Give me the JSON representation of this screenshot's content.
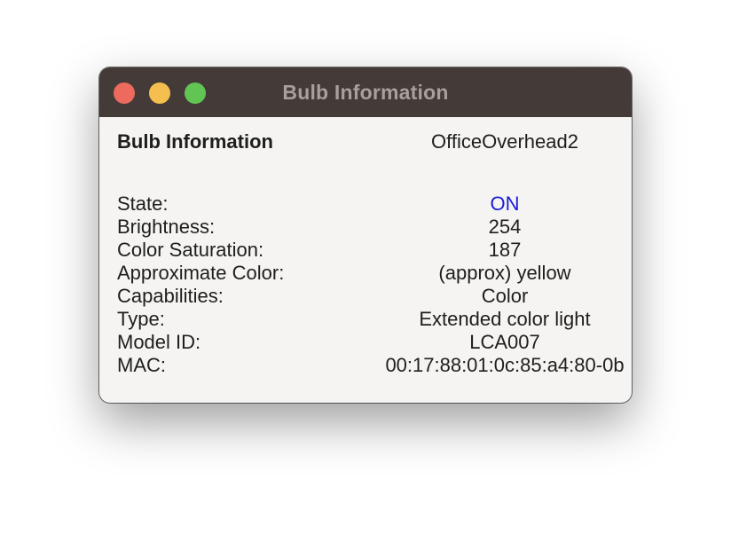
{
  "window": {
    "title": "Bulb Information"
  },
  "header": {
    "label": "Bulb Information",
    "value": "OfficeOverhead2"
  },
  "fields": [
    {
      "label": "State:",
      "value": "ON"
    },
    {
      "label": "Brightness:",
      "value": "254"
    },
    {
      "label": "Color Saturation:",
      "value": "187"
    },
    {
      "label": "Approximate Color:",
      "value": "(approx) yellow"
    },
    {
      "label": "Capabilities:",
      "value": "Color"
    },
    {
      "label": "Type:",
      "value": "Extended color light"
    },
    {
      "label": "Model ID:",
      "value": "LCA007"
    },
    {
      "label": "MAC:",
      "value": "00:17:88:01:0c:85:a4:80-0b"
    }
  ],
  "colors": {
    "titlebar": "#443a37",
    "state_on": "#1a1ad6",
    "close": "#ec6a5e",
    "minimize": "#f4bf4f",
    "maximize": "#61c554"
  }
}
